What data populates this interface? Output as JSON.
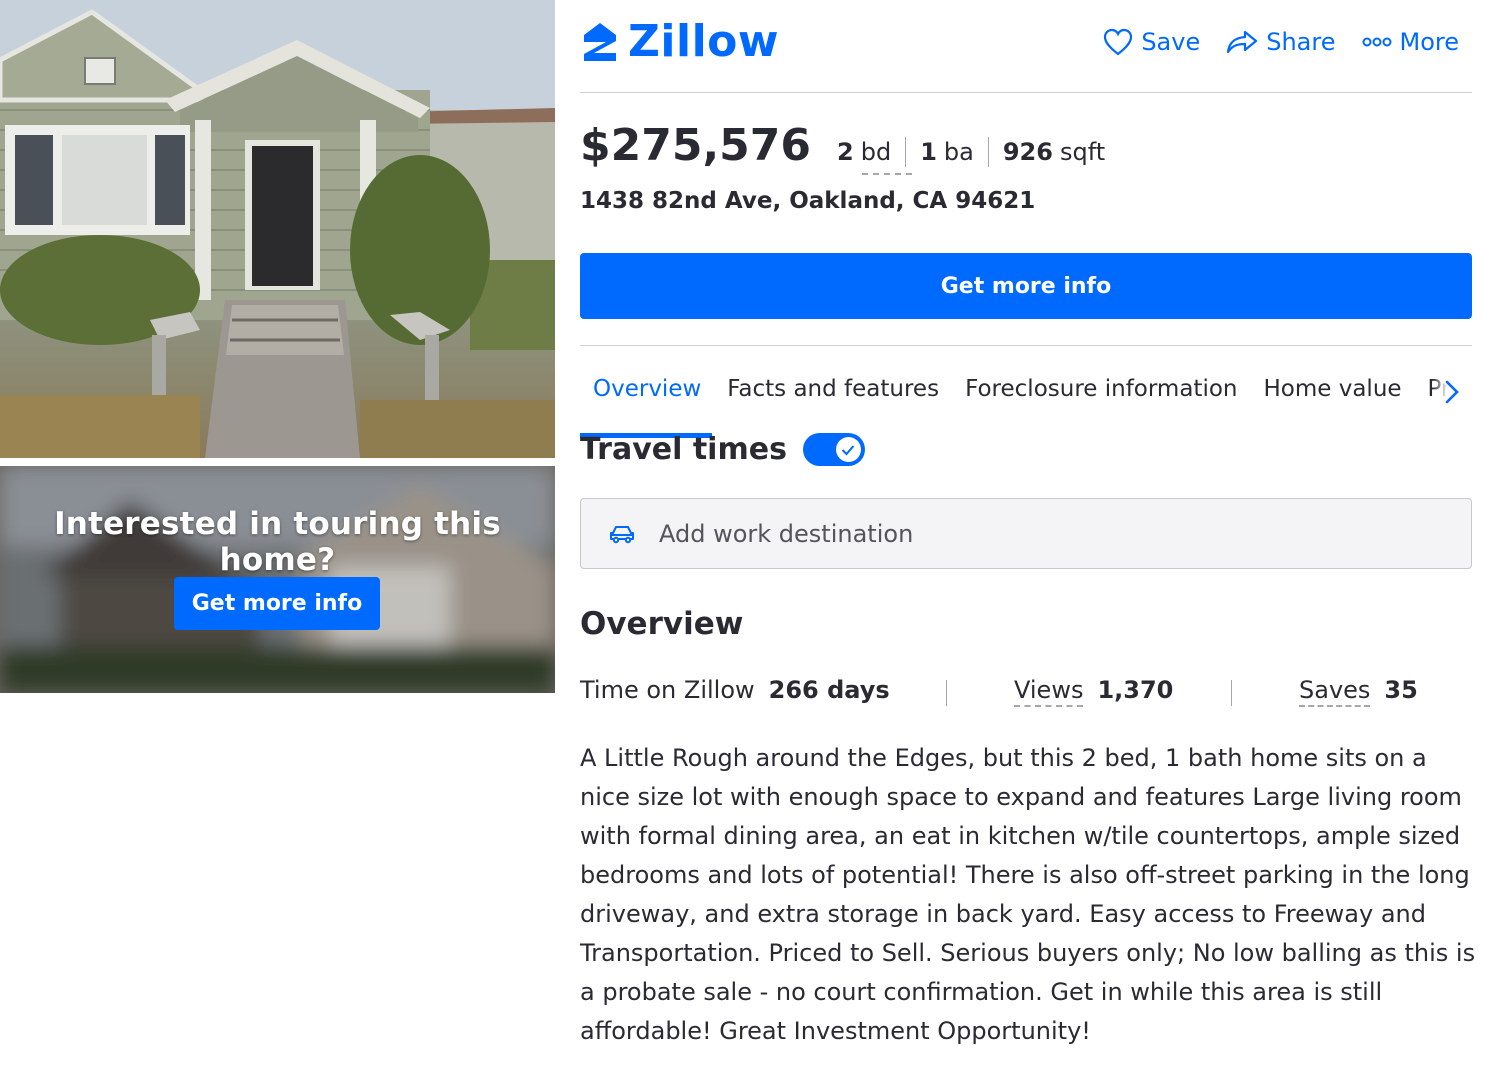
{
  "brand": {
    "name": "Zillow",
    "color": "#006aff"
  },
  "header": {
    "actions": [
      {
        "label": "Save",
        "icon": "heart-icon"
      },
      {
        "label": "Share",
        "icon": "share-arrow-icon"
      },
      {
        "label": "More",
        "icon": "more-dots-icon"
      }
    ]
  },
  "listing": {
    "price": "$275,576",
    "beds": {
      "value": "2",
      "unit": "bd"
    },
    "baths": {
      "value": "1",
      "unit": "ba"
    },
    "sqft": {
      "value": "926",
      "unit": "sqft"
    },
    "address": "1438 82nd Ave, Oakland, CA 94621"
  },
  "cta": {
    "main_label": "Get more info"
  },
  "tour": {
    "title": "Interested in touring this home?",
    "button_label": "Get more info"
  },
  "tabs": [
    {
      "label": "Overview",
      "active": true
    },
    {
      "label": "Facts and features",
      "active": false
    },
    {
      "label": "Foreclosure information",
      "active": false
    },
    {
      "label": "Home value",
      "active": false
    },
    {
      "label": "Pr",
      "active": false
    }
  ],
  "travel": {
    "title": "Travel times",
    "toggle_on": true,
    "input_placeholder": "Add work destination",
    "input_icon": "car-icon"
  },
  "overview": {
    "title": "Overview",
    "stats": [
      {
        "label": "Time on Zillow",
        "value": "266 days"
      },
      {
        "label": "Views",
        "value": "1,370"
      },
      {
        "label": "Saves",
        "value": "35"
      }
    ],
    "description": "A Little Rough around the Edges, but this 2 bed, 1 bath home sits on a nice size lot with enough space to expand and features Large living room with formal dining area, an eat in kitchen w/tile countertops, ample sized bedrooms and lots of potential! There is also off-street parking in the long driveway, and extra storage in back yard. Easy access to Freeway and Transportation.  Priced to Sell.  Serious buyers only; No low balling as this is a probate sale - no court confirmation.  Get in while this area is still affordable! Great Investment Opportunity!"
  }
}
